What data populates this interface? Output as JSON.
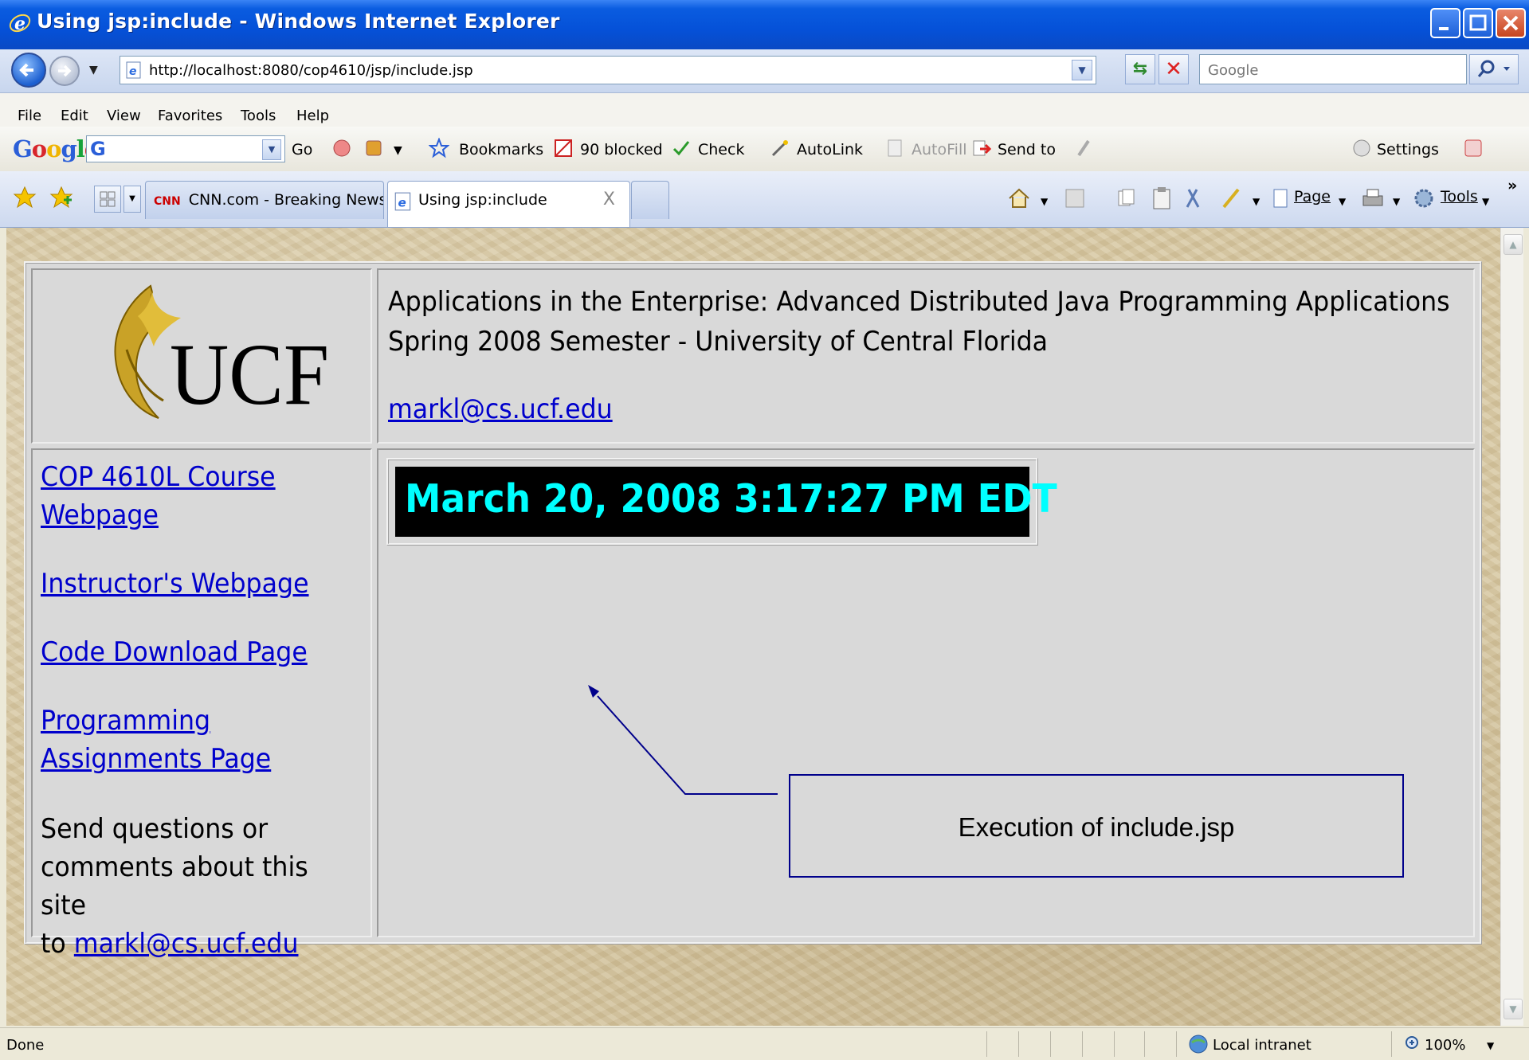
{
  "window": {
    "title": "Using jsp:include - Windows Internet Explorer"
  },
  "addressbar": {
    "url": "http://localhost:8080/cop4610/jsp/include.jsp",
    "search_placeholder": "Google"
  },
  "menu": {
    "items": [
      "File",
      "Edit",
      "View",
      "Favorites",
      "Tools",
      "Help"
    ]
  },
  "google_toolbar": {
    "logo": "Google",
    "search_value": "G",
    "go_label": "Go",
    "bookmarks_label": "Bookmarks",
    "blocked_label": "90 blocked",
    "check_label": "Check",
    "autolink_label": "AutoLink",
    "autofill_label": "AutoFill",
    "sendto_label": "Send to",
    "settings_label": "Settings"
  },
  "tabs": [
    {
      "label": "CNN.com - Breaking News, U...",
      "logo": "CNN"
    },
    {
      "label": "Using jsp:include",
      "close": "X"
    }
  ],
  "command_bar": {
    "page_label": "Page",
    "tools_label": "Tools",
    "more": "»"
  },
  "page": {
    "logo_text": "UCF",
    "header_line1": "Applications in the Enterprise: Advanced Distributed Java Programming Applications",
    "header_line2": "Spring 2008 Semester - University of Central Florida",
    "header_email": "markl@cs.ucf.edu",
    "nav": {
      "course_link_l1": "COP 4610L Course",
      "course_link_l2": "Webpage",
      "instructor_link": "Instructor's Webpage",
      "code_link": "Code Download Page",
      "prog_link_l1": "Programming",
      "prog_link_l2": "Assignments Page",
      "send_l1": "Send questions or",
      "send_l2": "comments about this site",
      "send_to": "to ",
      "send_email": "markl@cs.ucf.edu"
    },
    "datetime": "March 20, 2008 3:17:27 PM EDT"
  },
  "annotation": {
    "label": "Execution of include.jsp"
  },
  "status": {
    "text": "Done",
    "zone": "Local intranet",
    "zoom": "100%"
  },
  "colors": {
    "titlebar": "#0551d8",
    "link": "#0000cc",
    "datetime_text": "#00ffff",
    "datetime_bg": "#000000",
    "callout_border": "#00008b"
  }
}
